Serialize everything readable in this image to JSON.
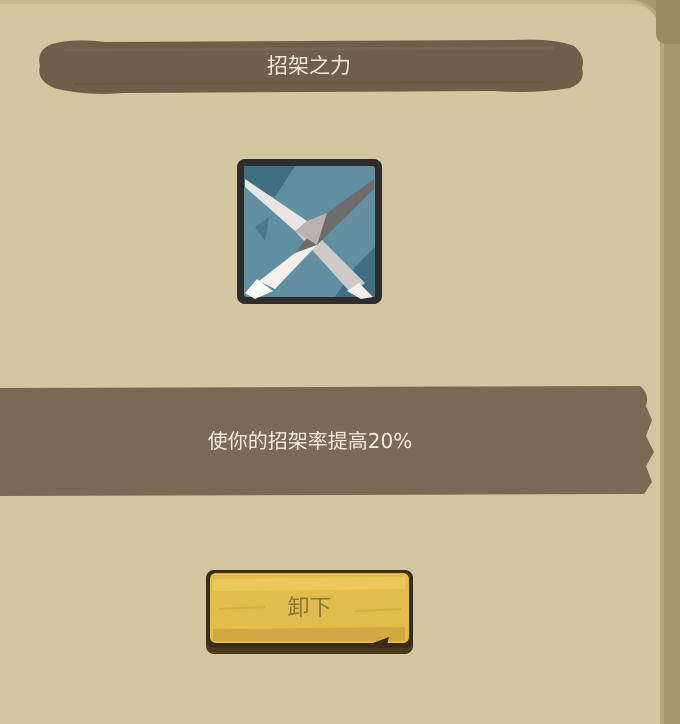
{
  "dialog": {
    "title": "招架之力",
    "skill_icon": "crossed-blades-icon",
    "description": "使你的招架率提高20%",
    "unequip_label": "卸下"
  },
  "colors": {
    "panel": "#d4c6a0",
    "banner": "#6f5f4a",
    "desc_band": "#7b6955",
    "button": "#e3bd4c",
    "icon_bg": "#5f8fa0"
  }
}
